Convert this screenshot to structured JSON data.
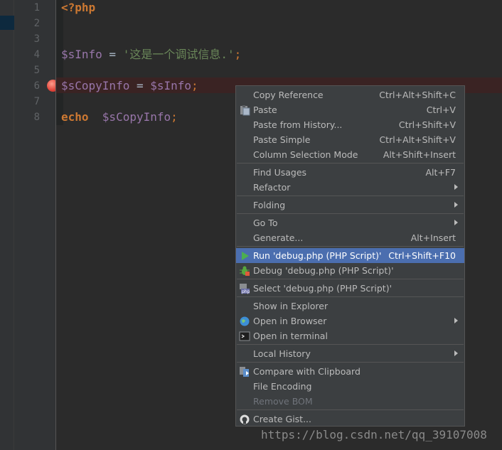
{
  "editor": {
    "line_numbers": [
      "1",
      "2",
      "3",
      "4",
      "5",
      "6",
      "7",
      "8"
    ],
    "lines": {
      "l1": {
        "kw": "<?php"
      },
      "l4": {
        "var": "$sInfo",
        "op": " = ",
        "str": "'这是一个调试信息.'",
        "semi": ";"
      },
      "l6": {
        "var1": "$sCopyInfo",
        "op": " = ",
        "var2": "$sInfo",
        "semi": ";"
      },
      "l8": {
        "kw": "echo",
        "sp": "  ",
        "var": "$sCopyInfo",
        "semi": ";"
      }
    }
  },
  "context_menu": {
    "items": [
      {
        "label": "Copy Reference",
        "shortcut": "Ctrl+Alt+Shift+C"
      },
      {
        "label": "Paste",
        "shortcut": "Ctrl+V",
        "icon": "paste-icon"
      },
      {
        "label": "Paste from History...",
        "shortcut": "Ctrl+Shift+V"
      },
      {
        "label": "Paste Simple",
        "shortcut": "Ctrl+Alt+Shift+V"
      },
      {
        "label": "Column Selection Mode",
        "shortcut": "Alt+Shift+Insert"
      },
      {
        "label": "Find Usages",
        "shortcut": "Alt+F7"
      },
      {
        "label": "Refactor",
        "submenu": true
      },
      {
        "label": "Folding",
        "submenu": true
      },
      {
        "label": "Go To",
        "submenu": true
      },
      {
        "label": "Generate...",
        "shortcut": "Alt+Insert"
      },
      {
        "label": "Run 'debug.php (PHP Script)'",
        "shortcut": "Ctrl+Shift+F10",
        "icon": "run-icon",
        "selected": true
      },
      {
        "label": "Debug 'debug.php (PHP Script)'",
        "icon": "debug-icon"
      },
      {
        "label": "Select 'debug.php (PHP Script)'",
        "icon": "php-script-icon"
      },
      {
        "label": "Show in Explorer"
      },
      {
        "label": "Open in Browser",
        "submenu": true,
        "icon": "globe-icon"
      },
      {
        "label": "Open in terminal",
        "icon": "terminal-icon"
      },
      {
        "label": "Local History",
        "submenu": true
      },
      {
        "label": "Compare with Clipboard",
        "icon": "compare-icon"
      },
      {
        "label": "File Encoding"
      },
      {
        "label": "Remove BOM",
        "disabled": true
      },
      {
        "label": "Create Gist...",
        "icon": "github-icon"
      }
    ]
  },
  "watermark": "https://blog.csdn.net/qq_39107008",
  "colors": {
    "selection": "#4b6eaf",
    "menu_bg": "#3c3f41",
    "breakpoint": "#e0443a"
  }
}
